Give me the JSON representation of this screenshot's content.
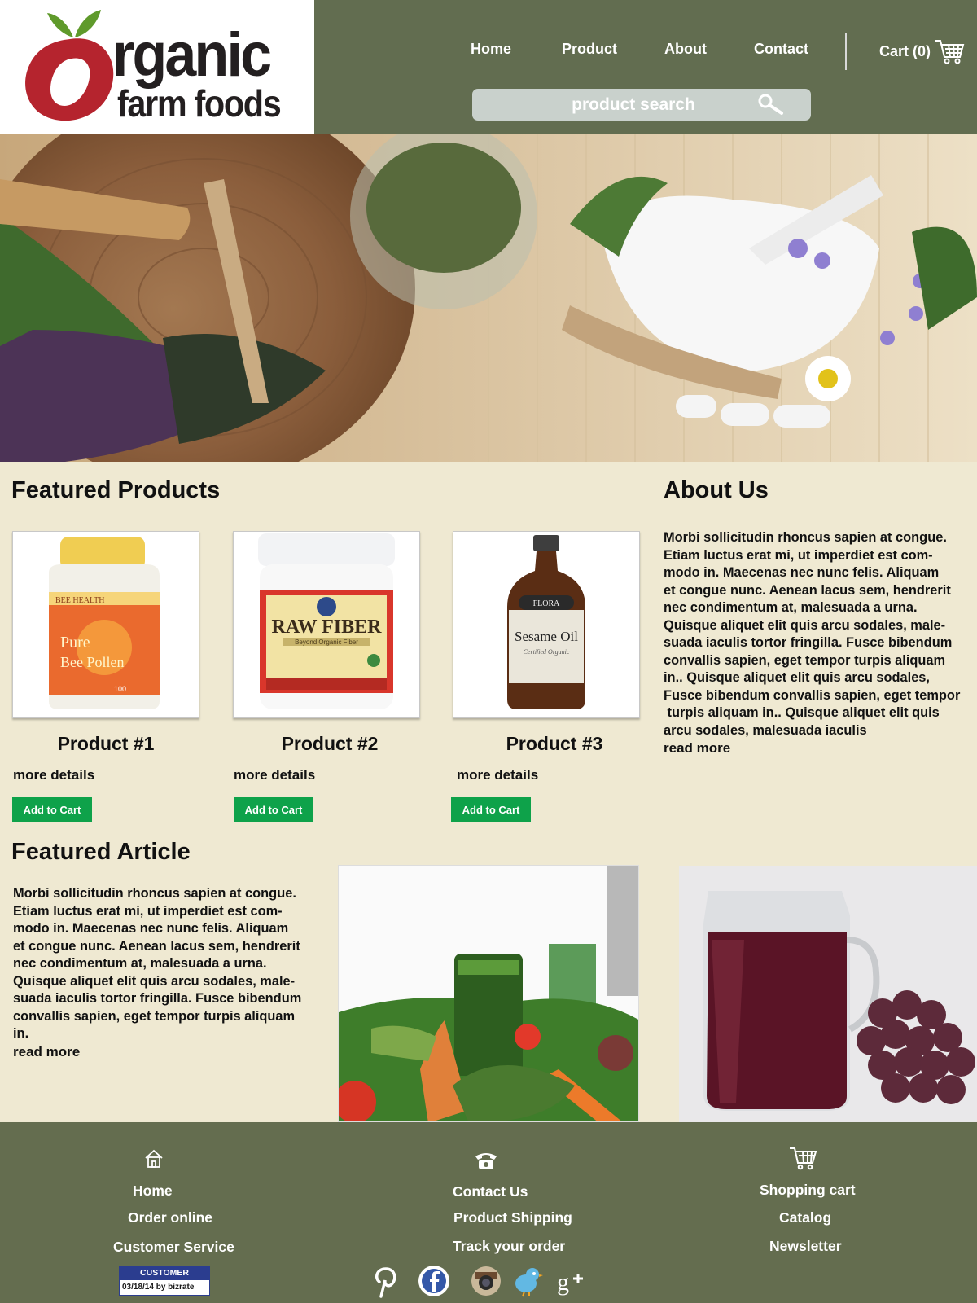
{
  "logo": {
    "word1": "rganic",
    "word2": "farm foods"
  },
  "nav": {
    "items": [
      "Home",
      "Product",
      "About",
      "Contact"
    ],
    "cart": "Cart (0)"
  },
  "search": {
    "placeholder": "product search"
  },
  "featured": {
    "heading": "Featured Products",
    "products": [
      {
        "title": "Product #1",
        "details": "more details",
        "button": "Add to Cart",
        "image": "Pure Bee Pollen jar"
      },
      {
        "title": "Product #2",
        "details": "more details",
        "button": "Add to Cart",
        "image": "Raw Fiber tub"
      },
      {
        "title": "Product #3",
        "details": "more details",
        "button": "Add to Cart",
        "image": "Sesame Oil bottle"
      }
    ]
  },
  "product_labels": {
    "p1": {
      "brand": "BEE HEALTH",
      "name_1": "Pure",
      "name_2": "Bee Pollen",
      "count": "100"
    },
    "p2": {
      "name": "RAW FIBER",
      "sub": "Beyond Organic Fiber"
    },
    "p3": {
      "brand": "FLORA",
      "name": "Sesame Oil",
      "sub": "Certified Organic"
    }
  },
  "about": {
    "heading": "About Us",
    "lines": [
      "Morbi sollicitudin rhoncus sapien at congue.",
      "Etiam luctus erat mi, ut imperdiet est com-",
      "modo in. Maecenas nec nunc felis. Aliquam",
      "et congue nunc. Aenean lacus sem, hendrerit",
      "nec condimentum at, malesuada a urna.",
      "Quisque aliquet elit quis arcu sodales, male-",
      "suada iaculis tortor fringilla. Fusce bibendum",
      "convallis sapien, eget tempor turpis aliquam",
      "in.. Quisque aliquet elit quis arcu sodales,",
      "Fusce bibendum convallis sapien, eget tempor",
      " turpis aliquam in.. Quisque aliquet elit quis",
      "arcu sodales, malesuada iaculis"
    ],
    "read_more": "read more"
  },
  "article": {
    "heading": "Featured Article",
    "lines": [
      "Morbi sollicitudin rhoncus sapien at congue.",
      "Etiam luctus erat mi, ut imperdiet est com-",
      "modo in. Maecenas nec nunc felis. Aliquam",
      "et congue nunc. Aenean lacus sem, hendrerit",
      "nec condimentum at, malesuada a urna.",
      "Quisque aliquet elit quis arcu sodales, male-",
      "suada iaculis tortor fringilla. Fusce bibendum",
      "convallis sapien, eget tempor turpis aliquam",
      "in."
    ],
    "read_more": "read more"
  },
  "footer": {
    "col1": {
      "icon": "home-icon",
      "links": [
        "Home",
        "Order online",
        "Customer Service"
      ]
    },
    "col2": {
      "icon": "phone-icon",
      "links": [
        "Contact Us",
        "Product Shipping",
        "Track your order"
      ]
    },
    "col3": {
      "icon": "shopping-cart-icon",
      "links": [
        "Shopping cart",
        "Catalog",
        "Newsletter"
      ]
    },
    "badge": {
      "top": "CUSTOMER CERTIFIED",
      "bottom": "03/18/14 by bizrate"
    },
    "social": [
      "pinterest-icon",
      "facebook-icon",
      "instagram-icon",
      "twitter-icon",
      "google-plus-icon"
    ]
  },
  "colors": {
    "header_bg": "#626d50",
    "page_bg": "#efe9d2",
    "button_green": "#0ea24a",
    "logo_red": "#b5242e",
    "logo_green": "#5f9a2b"
  }
}
